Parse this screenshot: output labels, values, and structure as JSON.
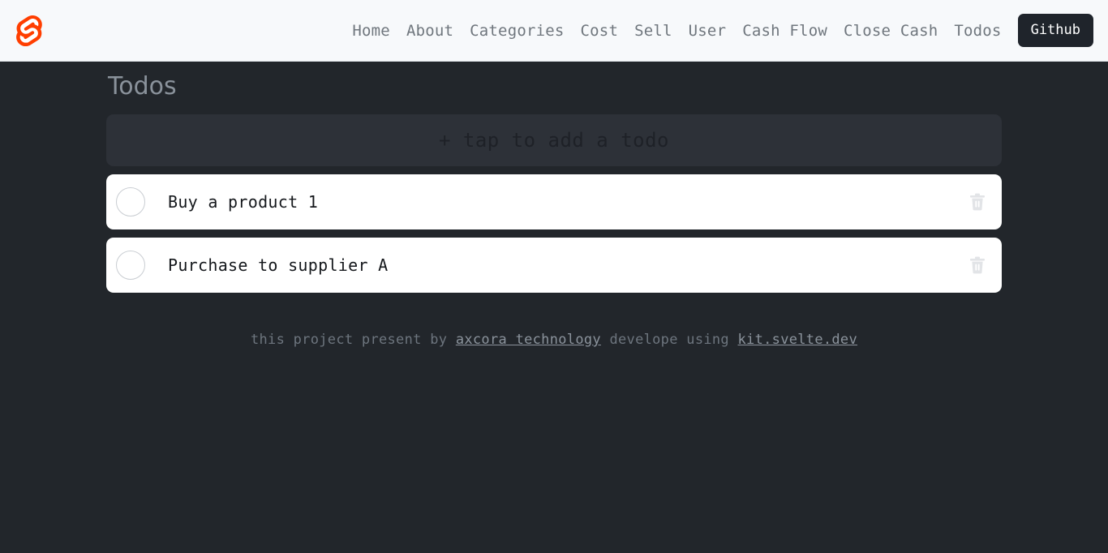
{
  "brand": {
    "logo_icon": "svelte-logo-icon",
    "logo_color": "#ff3e00"
  },
  "nav": {
    "links": [
      {
        "label": "Home",
        "name": "nav-link-home"
      },
      {
        "label": "About",
        "name": "nav-link-about"
      },
      {
        "label": "Categories",
        "name": "nav-link-categories"
      },
      {
        "label": "Cost",
        "name": "nav-link-cost"
      },
      {
        "label": "Sell",
        "name": "nav-link-sell"
      },
      {
        "label": "User",
        "name": "nav-link-user"
      },
      {
        "label": "Cash Flow",
        "name": "nav-link-cash-flow"
      },
      {
        "label": "Close Cash",
        "name": "nav-link-close-cash"
      },
      {
        "label": "Todos",
        "name": "nav-link-todos"
      }
    ],
    "github_button": {
      "label": "Github",
      "bg_color": "#1f242b",
      "text_color": "#ffffff"
    },
    "bg_color": "#f7f9fb"
  },
  "main": {
    "bg_color": "#22262b",
    "page_title": "Todos",
    "add_todo": {
      "label": "+ tap to add a todo",
      "bg_color": "#2d3138",
      "text_color": "#1e2127"
    },
    "todos": [
      {
        "text": "Buy a product 1",
        "checked": false,
        "checkbox_icon": "circle-unchecked-icon",
        "delete_icon": "trash-icon"
      },
      {
        "text": "Purchase to supplier A",
        "checked": false,
        "checkbox_icon": "circle-unchecked-icon",
        "delete_icon": "trash-icon"
      }
    ]
  },
  "footer": {
    "lead_text": "this project present by",
    "link_one": "axcora technology",
    "mid_text": "develope using",
    "link_two": "kit.svelte.dev"
  }
}
